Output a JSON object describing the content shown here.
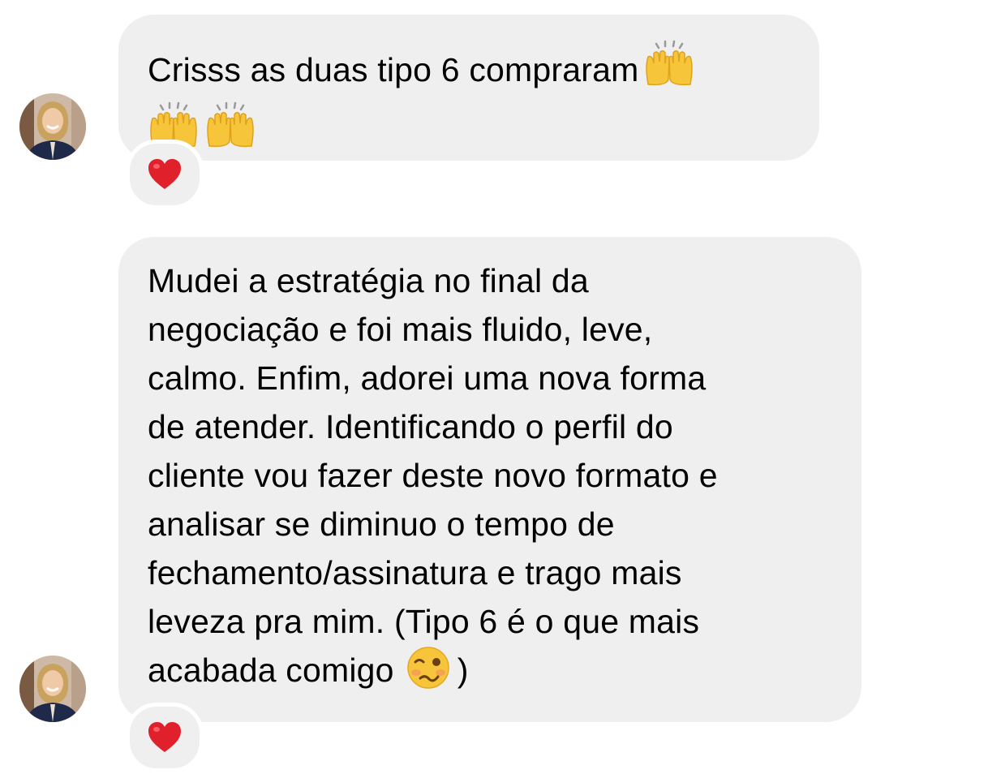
{
  "messages": [
    {
      "lines": [
        "Crisss as duas tipo 6 compraram",
        ""
      ],
      "emoji": [
        "raising-hands-emoji",
        "raising-hands-emoji",
        "raising-hands-emoji"
      ],
      "reaction": "heart-reaction-icon"
    },
    {
      "lines": [
        "Mudei a estratégia no final da",
        "negociação e foi mais fluido, leve,",
        "calmo. Enfim, adorei uma nova forma",
        "de atender. Identificando o perfil do",
        "cliente vou fazer deste novo formato e",
        "analisar se diminuo o tempo de",
        "fechamento/assinatura e trago mais",
        "leveza pra mim. (Tipo 6 é o que mais",
        "acabada comigo"
      ],
      "closing": ")",
      "emoji": [
        "woozy-face-emoji"
      ],
      "reaction": "heart-reaction-icon"
    }
  ],
  "colors": {
    "bubble": "#efefef",
    "text": "#000000",
    "heart": "#e0202a",
    "emoji_yellow": "#f7c53a"
  }
}
